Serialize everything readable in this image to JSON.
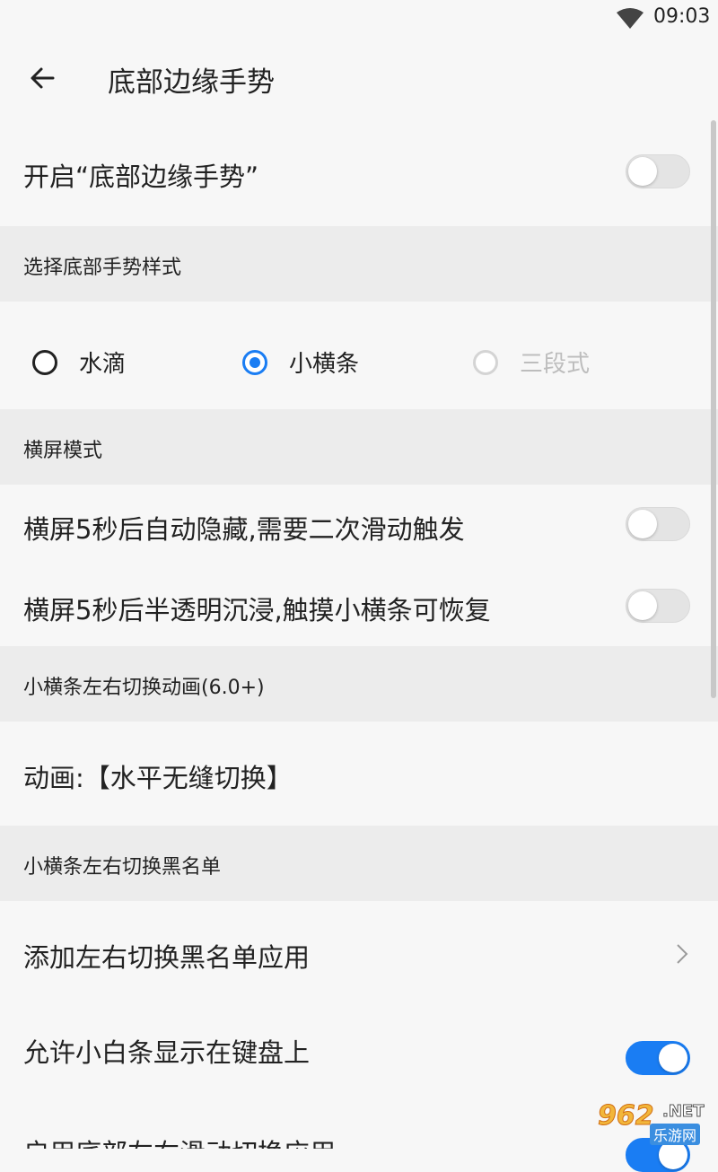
{
  "status_bar": {
    "time": "09:03",
    "wifi_icon": "wifi-icon"
  },
  "app_bar": {
    "back_icon": "back-arrow-icon",
    "title": "底部边缘手势"
  },
  "enable_row": {
    "label": "开启“底部边缘手势”",
    "toggle_on": false
  },
  "style_section": {
    "header": "选择底部手势样式",
    "options": [
      {
        "label": "水滴",
        "selected": false,
        "enabled": true
      },
      {
        "label": "小横条",
        "selected": true,
        "enabled": true
      },
      {
        "label": "三段式",
        "selected": false,
        "enabled": false
      }
    ]
  },
  "landscape_section": {
    "header": "横屏模式",
    "items": [
      {
        "label": "横屏5秒后自动隐藏,需要二次滑动触发",
        "toggle_on": false
      },
      {
        "label": "横屏5秒后半透明沉浸,触摸小横条可恢复",
        "toggle_on": false
      }
    ]
  },
  "animation_section": {
    "header": "小横条左右切换动画(6.0+)",
    "value_label": "动画:【水平无缝切换】"
  },
  "blacklist_section": {
    "header": "小横条左右切换黑名单",
    "add_label": "添加左右切换黑名单应用",
    "chevron_icon": "chevron-right-icon",
    "keyboard_label": "允许小白条显示在键盘上",
    "keyboard_toggle_on": true,
    "partial_label": "启用底部左右滑动切换应用",
    "partial_toggle_on": true
  },
  "watermark": {
    "big": "962",
    "small": "乐游网",
    "suffix": ".NET"
  },
  "colors": {
    "accent": "#1a7df3",
    "section_bg": "#ececec",
    "page_bg": "#f7f7f7"
  }
}
